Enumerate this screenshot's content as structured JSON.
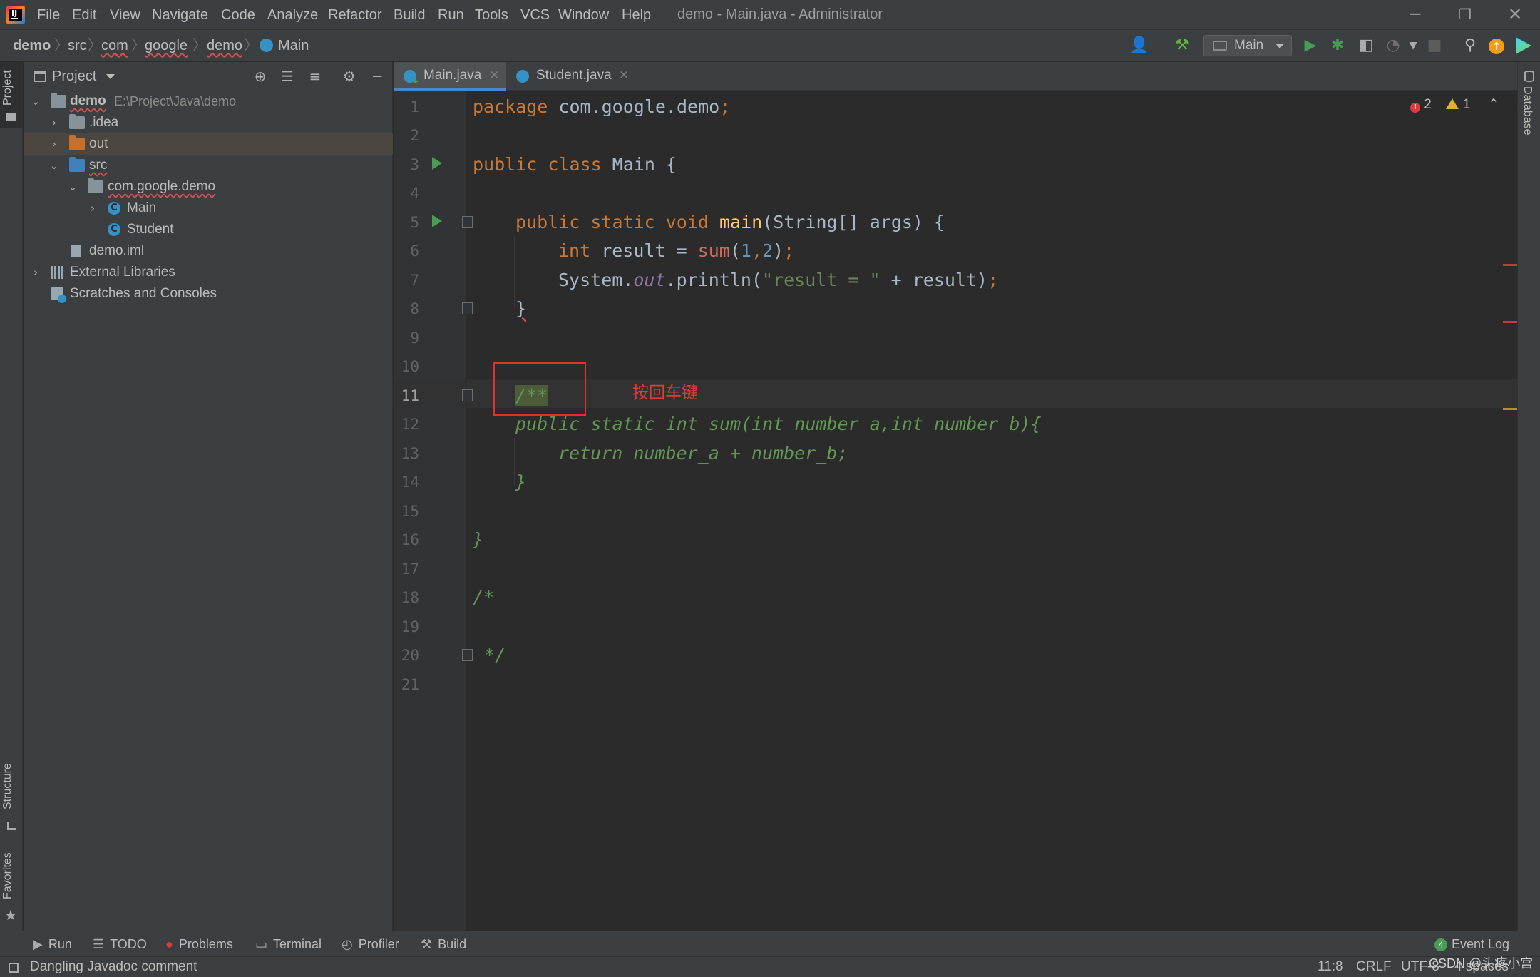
{
  "window": {
    "title": "demo - Main.java - Administrator",
    "menu": [
      "File",
      "Edit",
      "View",
      "Navigate",
      "Code",
      "Analyze",
      "Refactor",
      "Build",
      "Run",
      "Tools",
      "VCS",
      "Window",
      "Help"
    ],
    "controls": {
      "minimize": "─",
      "restore": "❐",
      "close": "✕"
    }
  },
  "breadcrumb": [
    "demo",
    "src",
    "com",
    "google",
    "demo",
    "Main"
  ],
  "toolbar": {
    "run_config": "Main",
    "icons": [
      "user-icon",
      "build-hammer-icon",
      "run-icon",
      "debug-icon",
      "coverage-icon",
      "profile-icon",
      "stop-icon",
      "search-icon",
      "update-icon",
      "plugin-icon"
    ]
  },
  "left_strip": {
    "project": "Project",
    "structure": "Structure",
    "favorites": "Favorites"
  },
  "right_strip": {
    "database": "Database"
  },
  "project_panel": {
    "title": "Project",
    "tree": [
      {
        "label": "demo",
        "path": "E:\\Project\\Java\\demo",
        "icon": "module-folder"
      },
      {
        "label": ".idea",
        "icon": "folder"
      },
      {
        "label": "out",
        "icon": "folder-excluded"
      },
      {
        "label": "src",
        "icon": "source-folder"
      },
      {
        "label": "com.google.demo",
        "icon": "package"
      },
      {
        "label": "Main",
        "icon": "class-runnable"
      },
      {
        "label": "Student",
        "icon": "class"
      },
      {
        "label": "demo.iml",
        "icon": "module-file"
      },
      {
        "label": "External Libraries",
        "icon": "library"
      },
      {
        "label": "Scratches and Consoles",
        "icon": "scratches"
      }
    ]
  },
  "editor": {
    "tabs": [
      {
        "label": "Main.java",
        "active": true
      },
      {
        "label": "Student.java",
        "active": false
      }
    ],
    "line_numbers": [
      "1",
      "2",
      "3",
      "4",
      "5",
      "6",
      "7",
      "8",
      "9",
      "10",
      "11",
      "12",
      "13",
      "14",
      "15",
      "16",
      "17",
      "18",
      "19",
      "20",
      "21"
    ],
    "current_line": 11,
    "inspections": {
      "errors": "2",
      "warnings": "1"
    },
    "code": {
      "l1": [
        "package",
        " com.google.demo",
        ";"
      ],
      "l3": [
        "public class",
        " Main {"
      ],
      "l5": [
        "public static void",
        " ",
        "main",
        "(String[] args) {"
      ],
      "l6": [
        "int",
        " result = ",
        "sum",
        "(",
        "1",
        ",",
        "2",
        ")",
        ";"
      ],
      "l7": [
        "System.",
        "out",
        ".println(",
        "\"result = \"",
        " + result)",
        ";"
      ],
      "l8": [
        "}"
      ],
      "l11": [
        "/**"
      ],
      "l12": [
        "public static int sum(int number_a,int number_b){"
      ],
      "l13": [
        "return number_a + number_b;"
      ],
      "l14": [
        "}"
      ],
      "l16": [
        "}"
      ],
      "l18": [
        "/*"
      ],
      "l20": [
        "*/"
      ]
    },
    "annotation": "按回车键"
  },
  "tool_windows": [
    {
      "label": "Run",
      "icon": "run-icon"
    },
    {
      "label": "TODO",
      "icon": "list-icon"
    },
    {
      "label": "Problems",
      "icon": "problems-icon"
    },
    {
      "label": "Terminal",
      "icon": "terminal-icon"
    },
    {
      "label": "Profiler",
      "icon": "profiler-icon"
    },
    {
      "label": "Build",
      "icon": "build-hammer-icon"
    }
  ],
  "event_log": {
    "count": "4",
    "label": "Event Log"
  },
  "status": {
    "message": "Dangling Javadoc comment",
    "position": "11:8",
    "line_separator": "CRLF",
    "encoding": "UTF-8",
    "indent": "4 spaces"
  },
  "watermark": "CSDN @头疼小宫",
  "colors": {
    "accent": "#4a88c7",
    "error": "#db3b3b",
    "warning": "#e0b032",
    "annotation_red": "#e03030"
  }
}
